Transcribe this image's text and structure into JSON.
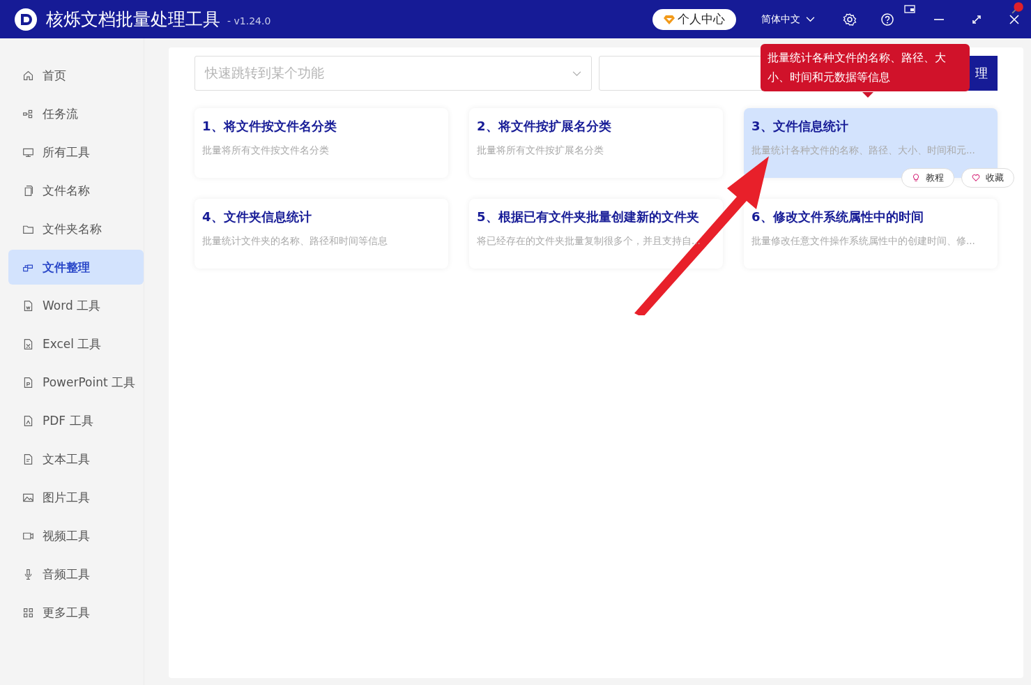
{
  "window": {
    "title": "核烁文档批量处理工具",
    "version": "- v1.24.0"
  },
  "header": {
    "account": "个人中心",
    "language": "简体中文"
  },
  "sidebar": {
    "items": [
      {
        "label": "首页",
        "selected": false
      },
      {
        "label": "任务流",
        "selected": false
      },
      {
        "label": "所有工具",
        "selected": false
      },
      {
        "label": "文件名称",
        "selected": false
      },
      {
        "label": "文件夹名称",
        "selected": false
      },
      {
        "label": "文件整理",
        "selected": true
      },
      {
        "label": "Word 工具",
        "selected": false
      },
      {
        "label": "Excel 工具",
        "selected": false
      },
      {
        "label": "PowerPoint 工具",
        "selected": false
      },
      {
        "label": "PDF 工具",
        "selected": false
      },
      {
        "label": "文本工具",
        "selected": false
      },
      {
        "label": "图片工具",
        "selected": false
      },
      {
        "label": "视频工具",
        "selected": false
      },
      {
        "label": "音频工具",
        "selected": false
      },
      {
        "label": "更多工具",
        "selected": false
      }
    ]
  },
  "search": {
    "placeholder": "快速跳转到某个功能",
    "button": "理"
  },
  "tooltip": "批量统计各种文件的名称、路径、大小、时间和元数据等信息",
  "cards": [
    {
      "title": "1、将文件按文件名分类",
      "description": "批量将所有文件按文件名分类",
      "selected": false
    },
    {
      "title": "2、将文件按扩展名分类",
      "description": "批量将所有文件按扩展名分类",
      "selected": false
    },
    {
      "title": "3、文件信息统计",
      "description": "批量统计各种文件的名称、路径、大小、时间和元...",
      "selected": true
    },
    {
      "title": "4、文件夹信息统计",
      "description": "批量统计文件夹的名称、路径和时间等信息",
      "selected": false
    },
    {
      "title": "5、根据已有文件夹批量创建新的文件夹",
      "description": "将已经存在的文件夹批量复制很多个，并且支持自...",
      "selected": false
    },
    {
      "title": "6、修改文件系统属性中的时间",
      "description": "批量修改任意文件操作系统属性中的创建时间、修...",
      "selected": false
    }
  ],
  "card_actions": [
    "教程",
    "收藏"
  ]
}
